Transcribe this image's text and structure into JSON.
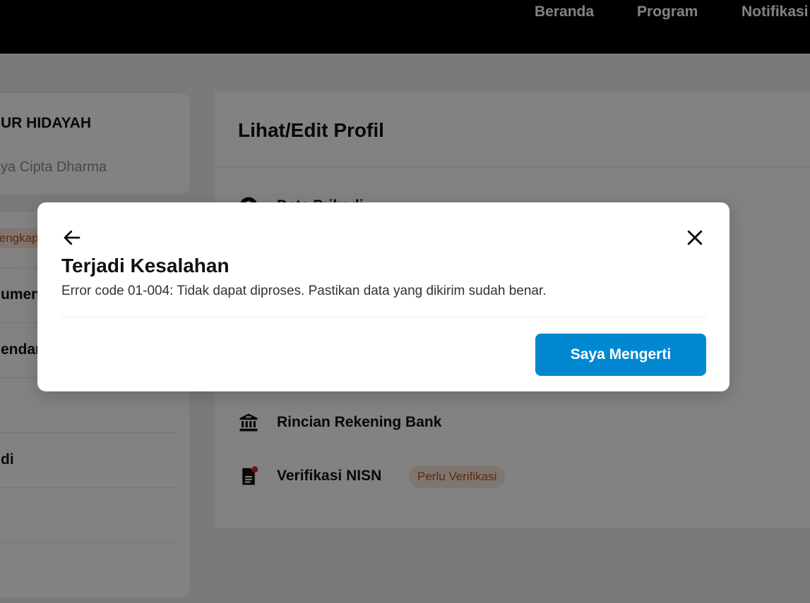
{
  "nav": {
    "items": [
      "Beranda",
      "Program",
      "Notifikasi"
    ]
  },
  "sidebar": {
    "profile": {
      "name": "UR HIDAYAH",
      "line1": "",
      "line2": "ya Cipta Dharma"
    },
    "menu": {
      "badge": "lengkap",
      "items": [
        "umen",
        "endar",
        "di"
      ]
    }
  },
  "main": {
    "title": "Lihat/Edit Profil",
    "rows": {
      "hidden": "Data Pribadi",
      "bank": "Rincian Rekening Bank",
      "nisn": "Verifikasi NISN",
      "nisn_status": "Perlu Verifikasi"
    }
  },
  "modal": {
    "title": "Terjadi Kesalahan",
    "message": "Error code 01-004: Tidak dapat diproses. Pastikan data yang dikirim sudah benar.",
    "button": "Saya Mengerti",
    "icons": {
      "back": "arrow-left-icon",
      "close": "close-icon"
    }
  },
  "colors": {
    "primary": "#0288d1",
    "badge_bg": "#fbe7dc",
    "badge_text": "#b3521f",
    "notification_dot": "#e02424"
  }
}
